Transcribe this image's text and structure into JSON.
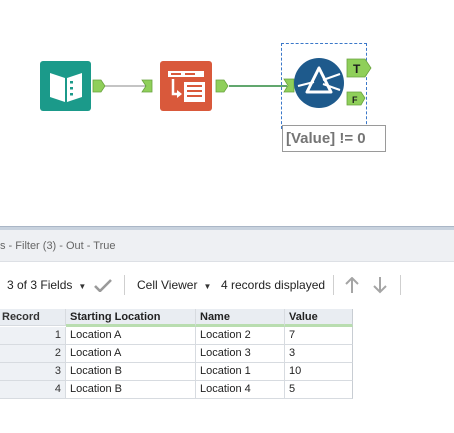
{
  "canvas": {
    "tools": [
      {
        "name": "Input",
        "color": "#1b9a8a"
      },
      {
        "name": "Select",
        "color": "#d9593b"
      },
      {
        "name": "Filter",
        "color": "#1e5a8c"
      }
    ],
    "filter_outputs": {
      "true_label": "T",
      "false_label": "F"
    },
    "filter_expression": "[Value] != 0",
    "connector_color": "#8fcf5a"
  },
  "results": {
    "title": "s - Filter (3) - Out - True",
    "toolbar": {
      "fields_label": "3 of 3 Fields",
      "viewer_label": "Cell Viewer",
      "records_label": "4 records displayed"
    },
    "columns": [
      "Record",
      "Starting Location",
      "Name",
      "Value"
    ],
    "rows": [
      {
        "record": "1",
        "starting_location": "Location A",
        "name": "Location 2",
        "value": "7"
      },
      {
        "record": "2",
        "starting_location": "Location A",
        "name": "Location 3",
        "value": "3"
      },
      {
        "record": "3",
        "starting_location": "Location B",
        "name": "Location 1",
        "value": "10"
      },
      {
        "record": "4",
        "starting_location": "Location B",
        "name": "Location 4",
        "value": "5"
      }
    ]
  }
}
